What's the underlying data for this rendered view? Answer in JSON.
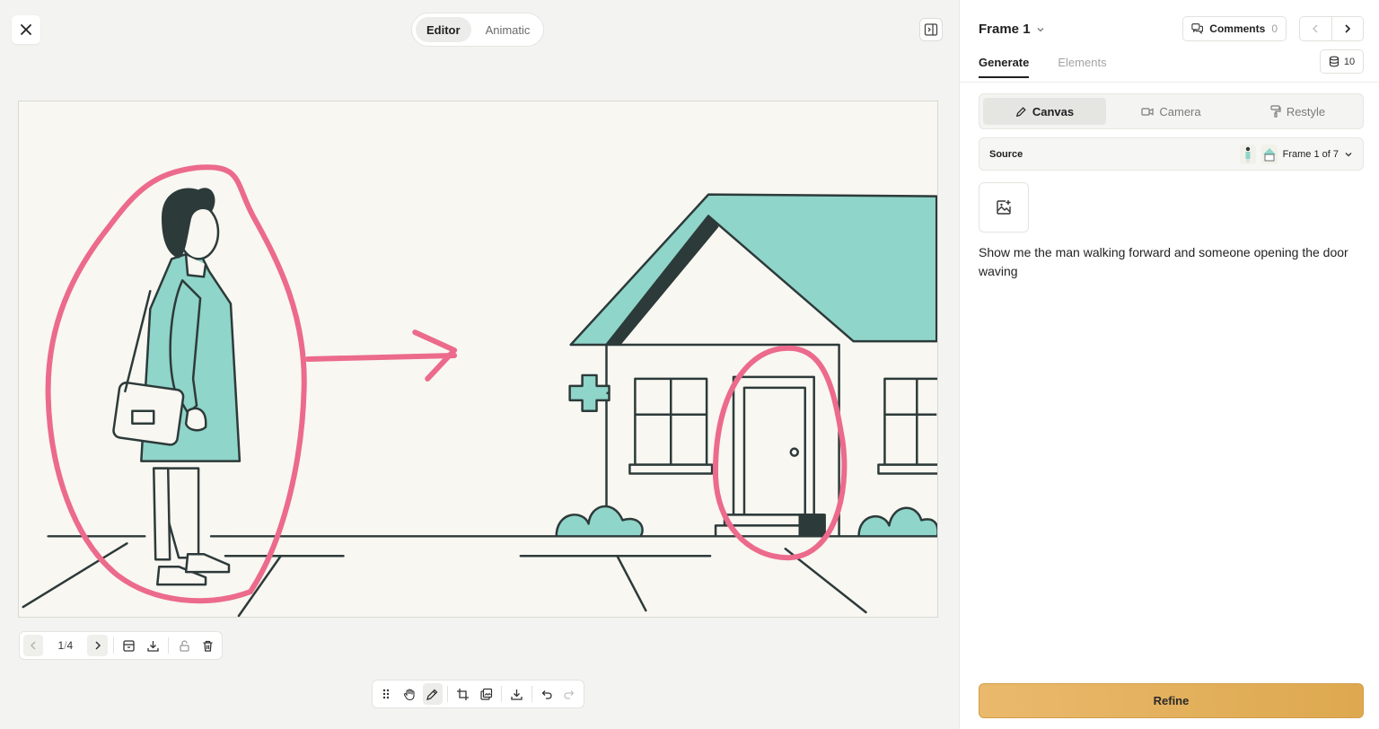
{
  "editor": {
    "close_icon": "close-icon",
    "modes": [
      {
        "label": "Editor",
        "active": true
      },
      {
        "label": "Animatic",
        "active": false
      }
    ],
    "panel_toggle_icon": "sidebar-toggle-icon",
    "frame_toolbar": {
      "page_current": "1",
      "page_sep": "/",
      "page_total": "4",
      "icons": [
        "chevron-left-icon",
        "chevron-right-icon",
        "archive-icon",
        "download-icon",
        "unlock-icon",
        "trash-icon"
      ]
    },
    "tool_toolbar": {
      "icons": [
        "drag-handle-icon",
        "hand-icon",
        "pen-icon",
        "crop-icon",
        "layers-icon",
        "download-icon",
        "undo-icon",
        "redo-icon"
      ],
      "active": "pen-icon"
    },
    "annotation_color": "#ec6a8c",
    "accent_color": "#8fd5c9"
  },
  "panel": {
    "frame_title": "Frame 1",
    "comments_label": "Comments",
    "comments_count": "0",
    "tabs": [
      {
        "label": "Generate",
        "active": true
      },
      {
        "label": "Elements",
        "active": false
      }
    ],
    "credits": "10",
    "segments": [
      {
        "label": "Canvas",
        "icon": "pen-icon",
        "active": true
      },
      {
        "label": "Camera",
        "icon": "video-icon",
        "active": false
      },
      {
        "label": "Restyle",
        "icon": "paint-roller-icon",
        "active": false
      }
    ],
    "source_label": "Source",
    "source_value": "Frame 1 of 7",
    "prompt": "Show me the man walking forward and someone opening the door waving",
    "refine_label": "Refine",
    "refine_color": "#e5b35e"
  }
}
